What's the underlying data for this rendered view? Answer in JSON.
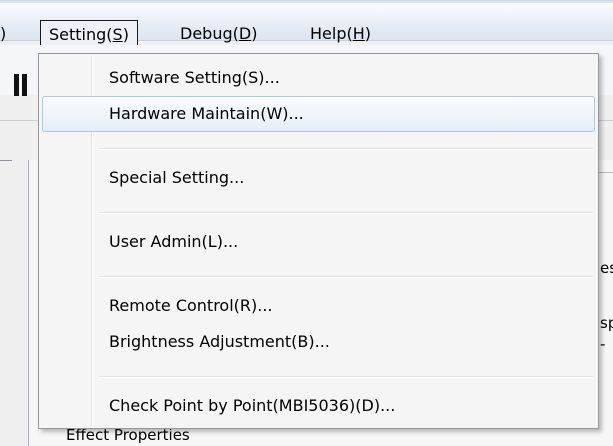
{
  "menubar": {
    "left_fragment": ")",
    "setting": {
      "prefix": "Setting(",
      "key": "S",
      "suffix": ")"
    },
    "debug": {
      "prefix": "Debug(",
      "key": "D",
      "suffix": ")"
    },
    "help": {
      "prefix": "Help(",
      "key": "H",
      "suffix": ")"
    }
  },
  "dropdown": {
    "items": [
      {
        "label": "Software Setting(S)..."
      },
      {
        "label": "Hardware Maintain(W)..."
      },
      {
        "label": "Special Setting..."
      },
      {
        "label": "User Admin(L)..."
      },
      {
        "label": "Remote Control(R)..."
      },
      {
        "label": "Brightness Adjustment(B)..."
      },
      {
        "label": "Check Point by Point(MBI5036)(D)..."
      }
    ],
    "highlighted_index": 1
  },
  "background": {
    "clip_1": "es",
    "clip_2": "sp",
    "clip_3": "-",
    "effect_properties": "Effect Properties"
  },
  "colors": {
    "menu_hover_border": "#a8c8ec",
    "menu_bg": "#f5f5f5"
  }
}
